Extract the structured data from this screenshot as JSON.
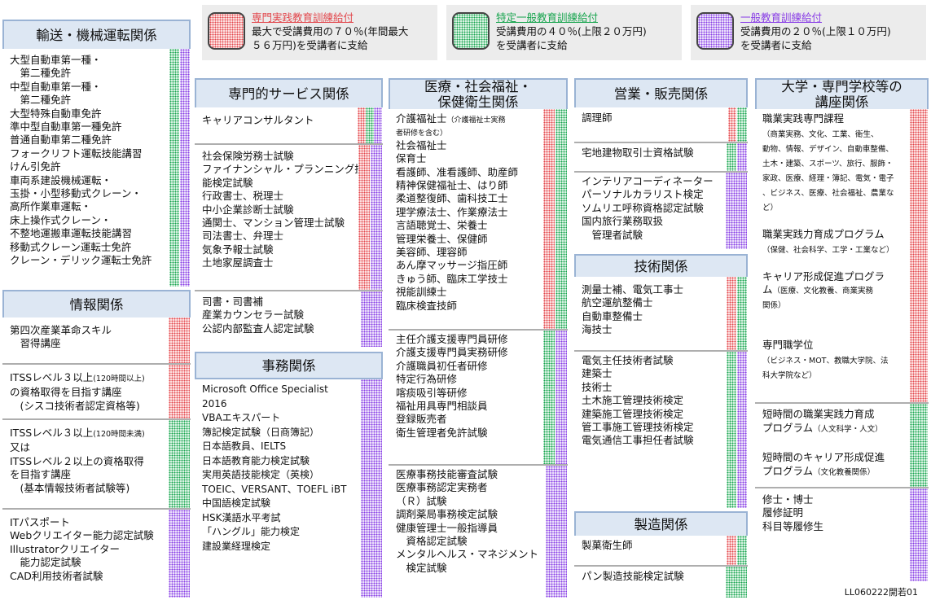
{
  "legend": [
    {
      "color": "#e2494e",
      "title": "専門実践教育訓練給付",
      "body": "最大で受講費用の７０％(年間最大\n５６万円)を受講者に支給"
    },
    {
      "color": "#1aa550",
      "title": "特定一般教育訓練給付",
      "body": "受講費用の４０％(上限２０万円)\nを受講者に支給"
    },
    {
      "color": "#8a3fe6",
      "title": "一般教育訓練給付",
      "body": "受講費用の２０％(上限１０万円)\nを受講者に支給"
    }
  ],
  "columns": [
    {
      "title": "輸送・機械運転関係",
      "groups": [
        {
          "text": "大型自動車第一種・\n　第二種免許\n中型自動車第一種・\n　第二種免許\n大型特殊自動車免許\n準中型自動車第一種免許\n普通自動車第二種免許\nフォークリフト運転技能講習\nけん引免許\n車両系建設機械運転・\n玉掛・小型移動式クレーン・\n高所作業車運転・\n床上操作式クレーン・\n不整地運搬車運転技能講習\n移動式クレーン運転士免許\nクレーン・デリック運転士免許"
        }
      ]
    },
    {
      "title": "情報関係",
      "groups": [
        {
          "text": "第四次産業革命スキル\n　習得講座"
        },
        {
          "text": "ITSSレベル３以上",
          "small": "(120時間以上)",
          "text2": "\nの資格取得を目指す講座\n　(シスコ技術者認定資格等)"
        },
        {
          "text": "ITSSレベル３以上",
          "small": "(120時間未満)",
          "text2": "\n又は\nITSSレベル２以上の資格取得\nを目指す講座\n　(基本情報技術者試験等)"
        },
        {
          "text": "ITパスポート\nWebクリエイター能力認定試験\nIllustratorクリエイター\n　能力認定試験\nCAD利用技術者試験"
        }
      ]
    },
    {
      "title": "専門的サービス関係",
      "groups": [
        {
          "text": "キャリアコンサルタント"
        },
        {
          "text": "社会保険労務士試験\nファイナンシャル・プランニング技\n能検定試験\n行政書士、税理士\n中小企業診断士試験\n通関士、マンション管理士試験\n司法書士、弁理士\n気象予報士試験\n土地家屋調査士"
        },
        {
          "text": "司書・司書補\n産業カウンセラー試験\n公認内部監査人認定試験"
        }
      ]
    },
    {
      "title": "事務関係",
      "groups": [
        {
          "text": "Microsoft Office Specialist\n2016\nVBAエキスパート\n簿記検定試験（日商簿記）\n日本語教員、IELTS\n日本語教育能力検定試験\n実用英語技能検定（英検）\nTOEIC、VERSANT、TOEFL iBT\n中国語検定試験\nHSK漢語水平考試\n「ハングル」能力検定\n建設業経理検定"
        }
      ]
    },
    {
      "title": "医療・社会福祉・\n保健衛生関係",
      "groups": [
        {
          "text": "介護福祉士",
          "small": "（介護福祉士実務\n者研修を含む）",
          "text2": "\n社会福祉士\n保育士\n看護師、准看護師、助産師\n精神保健福祉士、はり師\n柔道整復師、歯科技工士\n理学療法士、作業療法士\n言語聴覚士、栄養士\n管理栄養士、保健師\n美容師、理容師\nあん摩マッサージ指圧師\nきゅう師、臨床工学技士\n視能訓練士\n臨床検査技師"
        },
        {
          "text": "主任介護支援専門員研修\n介護支援専門員実務研修\n介護職員初任者研修\n特定行為研修\n喀痰吸引等研修\n福祉用具専門相談員\n登録販売者\n衛生管理者免許試験"
        },
        {
          "text": "医療事務技能審査試験\n医療事務認定実務者\n（Ｒ）試験\n調剤薬局事務検定試験\n健康管理士一般指導員\n　資格認定試験\nメンタルヘルス・マネジメント\n　検定試験"
        }
      ]
    },
    {
      "title": "営業・販売関係",
      "groups": [
        {
          "text": "調理師"
        },
        {
          "text": "宅地建物取引士資格試験"
        },
        {
          "text": "インテリアコーディネーター\nパーソナルカラリスト検定\nソムリエ呼称資格認定試験\n国内旅行業務取扱\n　管理者試験"
        }
      ]
    },
    {
      "title": "技術関係",
      "groups": [
        {
          "text": "測量士補、電気工事士\n航空運航整備士\n自動車整備士\n海技士"
        },
        {
          "text": "電気主任技術者試験\n建築士\n技術士\n土木施工管理技術検定\n建築施工管理技術検定\n管工事施工管理技術検定\n電気通信工事担任者試験"
        }
      ]
    },
    {
      "title": "製造関係",
      "groups": [
        {
          "text": "製菓衛生師"
        },
        {
          "text": "パン製造技能検定試験"
        }
      ]
    },
    {
      "title": "大学・専門学校等の\n講座関係",
      "groups": [
        {
          "text": "職業実践専門課程",
          "ps": "\n（商業実務、文化、工業、衛生、\n動物、情報、デザイン、自動車整備、\n土木・建築、スポーツ、旅行、服飾・\n家政、医療、経理・簿記、電気・電子\n、ビジネス、医療、社会福祉、農業な\nど）",
          "text3": "\n\n職業実践力育成プログラム",
          "ps2": "\n（保健、社会科学、工学・工業など）",
          "text4": "\n\nキャリア形成促進プログラ\nム",
          "ps3": "（医療、文化教養、商業実務\n関係）",
          "text5": "\n\n\n専門職学位",
          "ps4": "\n（ビジネス・MOT、教職大学院、法\n科大学院など）"
        },
        {
          "text": "短時間の職業実践力育成\nプログラム",
          "ps": "（人文科学・人文）",
          "text3": "\n\n短時間のキャリア形成促進\nプログラム",
          "ps2": "（文化教養関係）"
        },
        {
          "text": "修士・博士\n履修証明\n科目等履修生"
        }
      ]
    }
  ],
  "footer": "LL060222開若01"
}
